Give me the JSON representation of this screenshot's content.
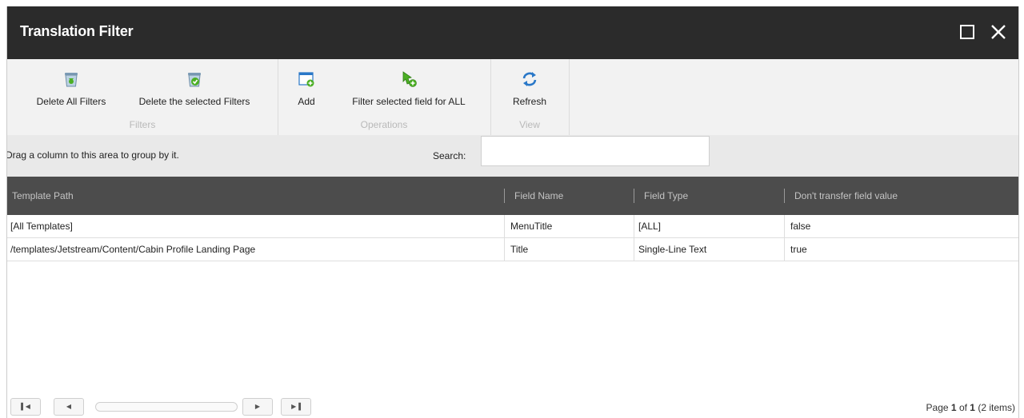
{
  "window": {
    "title": "Translation Filter",
    "maximize_icon": "maximize-icon",
    "close_icon": "close-icon"
  },
  "ribbon": {
    "groups": [
      {
        "label": "Filters",
        "buttons": [
          {
            "label": "Delete All Filters",
            "icon": "recycle-bin-icon"
          },
          {
            "label": "Delete the selected Filters",
            "icon": "recycle-bin-check-icon"
          }
        ]
      },
      {
        "label": "Operations",
        "buttons": [
          {
            "label": "Add",
            "icon": "add-window-icon"
          },
          {
            "label": "Filter selected field for ALL",
            "icon": "filter-add-icon"
          }
        ]
      },
      {
        "label": "View",
        "buttons": [
          {
            "label": "Refresh",
            "icon": "refresh-icon"
          }
        ]
      }
    ]
  },
  "group_area": {
    "hint": "Drag a column to this area to group by it.",
    "search_label": "Search:",
    "search_value": "",
    "search_placeholder": ""
  },
  "grid": {
    "columns": [
      "Template Path",
      "Field Name",
      "Field Type",
      "Don't transfer field value"
    ],
    "rows": [
      [
        "[All Templates]",
        "MenuTitle",
        "[ALL]",
        "false"
      ],
      [
        "/templates/Jetstream/Content/Cabin Profile Landing Page",
        "Title",
        "Single-Line Text",
        "true"
      ]
    ]
  },
  "pager": {
    "first_icon": "first-page-icon",
    "prev_icon": "prev-page-icon",
    "next_icon": "next-page-icon",
    "last_icon": "last-page-icon",
    "page_prefix": "Page",
    "page_current": "1",
    "page_of": "of",
    "page_total": "1",
    "items": "(2 items)"
  },
  "colors": {
    "titlebar": "#2b2b2b",
    "ribbon": "#f2f2f2",
    "header": "#4c4c4c",
    "icon_green": "#4caf24",
    "icon_blue": "#2a78c8"
  }
}
